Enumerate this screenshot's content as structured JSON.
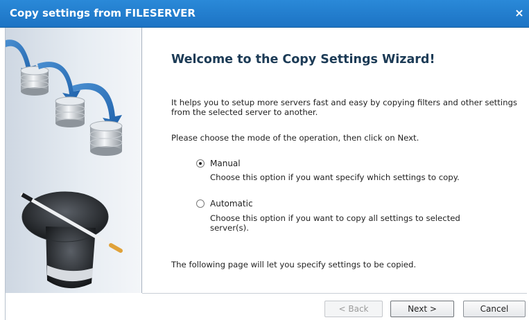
{
  "window": {
    "title": "Copy settings from FILESERVER"
  },
  "wizard": {
    "heading": "Welcome to the Copy Settings Wizard!",
    "intro": "It helps you to setup more servers fast and easy by copying filters and other settings from the selected server to another.",
    "instruction": "Please choose the mode of the operation, then click on Next.",
    "options": [
      {
        "label": "Manual",
        "description": "Choose this option if you want specify which settings to copy.",
        "selected": true
      },
      {
        "label": "Automatic",
        "description": "Choose this option if you want to copy all settings to selected server(s).",
        "selected": false
      }
    ],
    "footer_note": "The following page will let you specify settings to be copied."
  },
  "buttons": {
    "back": "< Back",
    "next": "Next >",
    "cancel": "Cancel"
  },
  "colors": {
    "titlebar": "#1c73c4",
    "heading": "#1c3b56"
  },
  "icons": {
    "close": "×",
    "side_art": "database-copy-and-magic-hat-illustration"
  }
}
